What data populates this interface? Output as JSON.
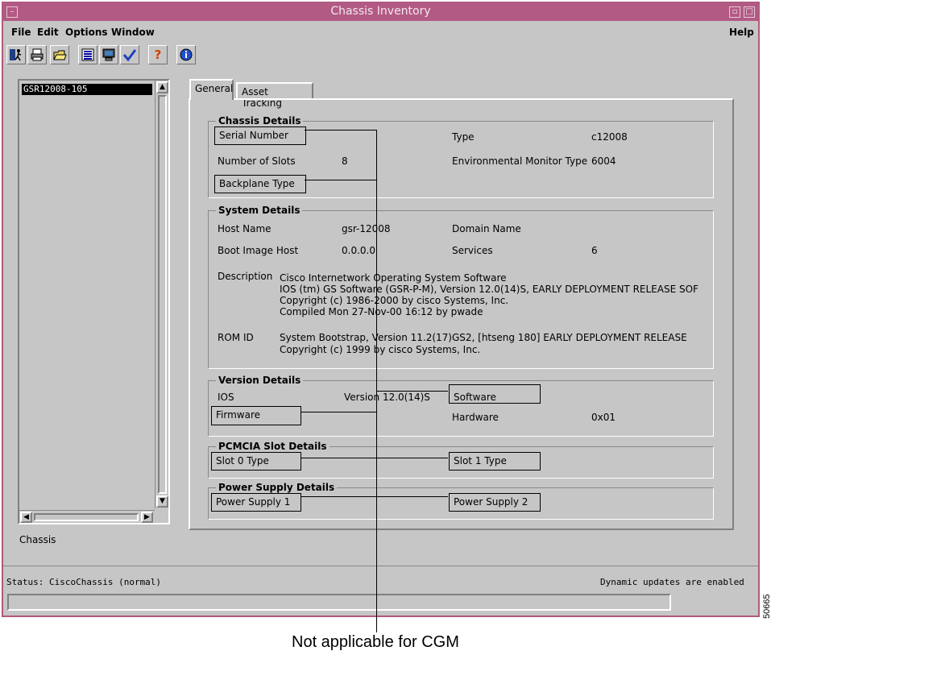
{
  "window": {
    "title": "Chassis Inventory",
    "minimize_glyph": "▫",
    "maximize_glyph": "□"
  },
  "menu": {
    "file": "File",
    "edit": "Edit",
    "options": "Options",
    "window": "Window",
    "help": "Help"
  },
  "toolbar": {
    "icons": [
      "exit-icon",
      "print-icon",
      "open-folder-icon",
      "list-icon",
      "monitor-icon",
      "checkmark-icon",
      "help-icon",
      "info-icon"
    ]
  },
  "tree": {
    "selected_item": "GSR12008-105",
    "caption": "Chassis"
  },
  "tabs": {
    "general": "General",
    "asset_tracking": "Asset Tracking"
  },
  "chassis_details": {
    "title": "Chassis Details",
    "serial_number_label": "Serial Number",
    "type_label": "Type",
    "type_value": "c12008",
    "slots_label": "Number of Slots",
    "slots_value": "8",
    "env_monitor_label": "Environmental Monitor Type",
    "env_monitor_value": "6004",
    "backplane_label": "Backplane Type"
  },
  "system_details": {
    "title": "System Details",
    "host_name_label": "Host Name",
    "host_name_value": "gsr-12008",
    "domain_name_label": "Domain Name",
    "boot_host_label": "Boot Image Host",
    "boot_host_value": "0.0.0.0",
    "services_label": "Services",
    "services_value": "6",
    "description_label": "Description",
    "description_lines": [
      "Cisco Internetwork Operating System Software",
      "IOS (tm) GS Software (GSR-P-M), Version 12.0(14)S, EARLY DEPLOYMENT RELEASE SOF",
      "Copyright (c) 1986-2000 by cisco Systems, Inc.",
      "Compiled Mon 27-Nov-00 16:12 by pwade"
    ],
    "rom_id_label": "ROM ID",
    "rom_id_lines": [
      "System Bootstrap, Version 11.2(17)GS2, [htseng 180] EARLY DEPLOYMENT RELEASE",
      "Copyright (c) 1999 by cisco Systems, Inc."
    ]
  },
  "version_details": {
    "title": "Version Details",
    "ios_label": "IOS",
    "ios_value": "Version 12.0(14)S",
    "software_label": "Software",
    "firmware_label": "Firmware",
    "hardware_label": "Hardware",
    "hardware_value": "0x01"
  },
  "pcmcia_details": {
    "title": "PCMCIA Slot Details",
    "slot0_label": "Slot 0 Type",
    "slot1_label": "Slot 1 Type"
  },
  "power_details": {
    "title": "Power Supply Details",
    "ps1_label": "Power Supply 1",
    "ps2_label": "Power Supply 2"
  },
  "status": {
    "left": "Status: CiscoChassis (normal)",
    "right": "Dynamic updates are enabled"
  },
  "annotation": {
    "callout": "Not applicable for CGM",
    "figure_id": "50665"
  }
}
